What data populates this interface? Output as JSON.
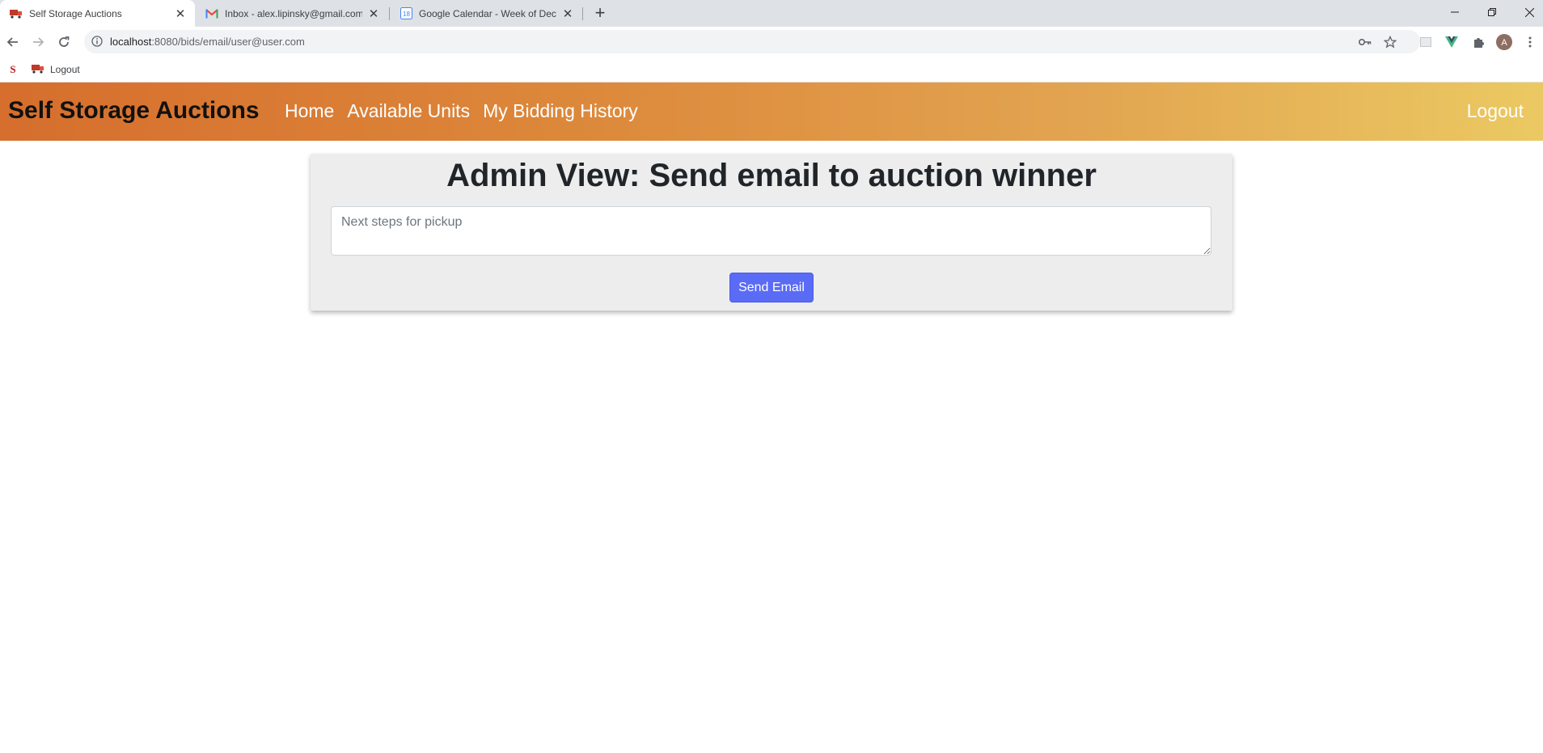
{
  "browser": {
    "tabs": [
      {
        "title": "Self Storage Auctions",
        "icon": "truck-icon",
        "active": true
      },
      {
        "title": "Inbox - alex.lipinsky@gmail.com",
        "icon": "gmail-icon",
        "active": false
      },
      {
        "title": "Google Calendar - Week of Dece",
        "icon": "calendar-icon",
        "active": false
      }
    ],
    "calendar_day": "18",
    "url_host": "localhost",
    "url_path": ":8080/bids/email/user@user.com",
    "profile_initial": "A",
    "bookmarks": [
      {
        "label": "",
        "icon": "storage-s-icon"
      },
      {
        "label": "Logout",
        "icon": "truck-icon"
      }
    ]
  },
  "app": {
    "brand": "Self Storage Auctions",
    "nav": [
      {
        "label": "Home"
      },
      {
        "label": "Available Units"
      },
      {
        "label": "My Bidding History"
      }
    ],
    "logout": "Logout"
  },
  "email_form": {
    "title": "Admin View: Send email to auction winner",
    "message_value": "",
    "message_placeholder": "Next steps for pickup",
    "submit_label": "Send Email"
  },
  "colors": {
    "header_gradient_start": "#d66e2d",
    "header_gradient_end": "#ebc962",
    "button": "#5a6bf5",
    "card_bg": "#ededed"
  }
}
